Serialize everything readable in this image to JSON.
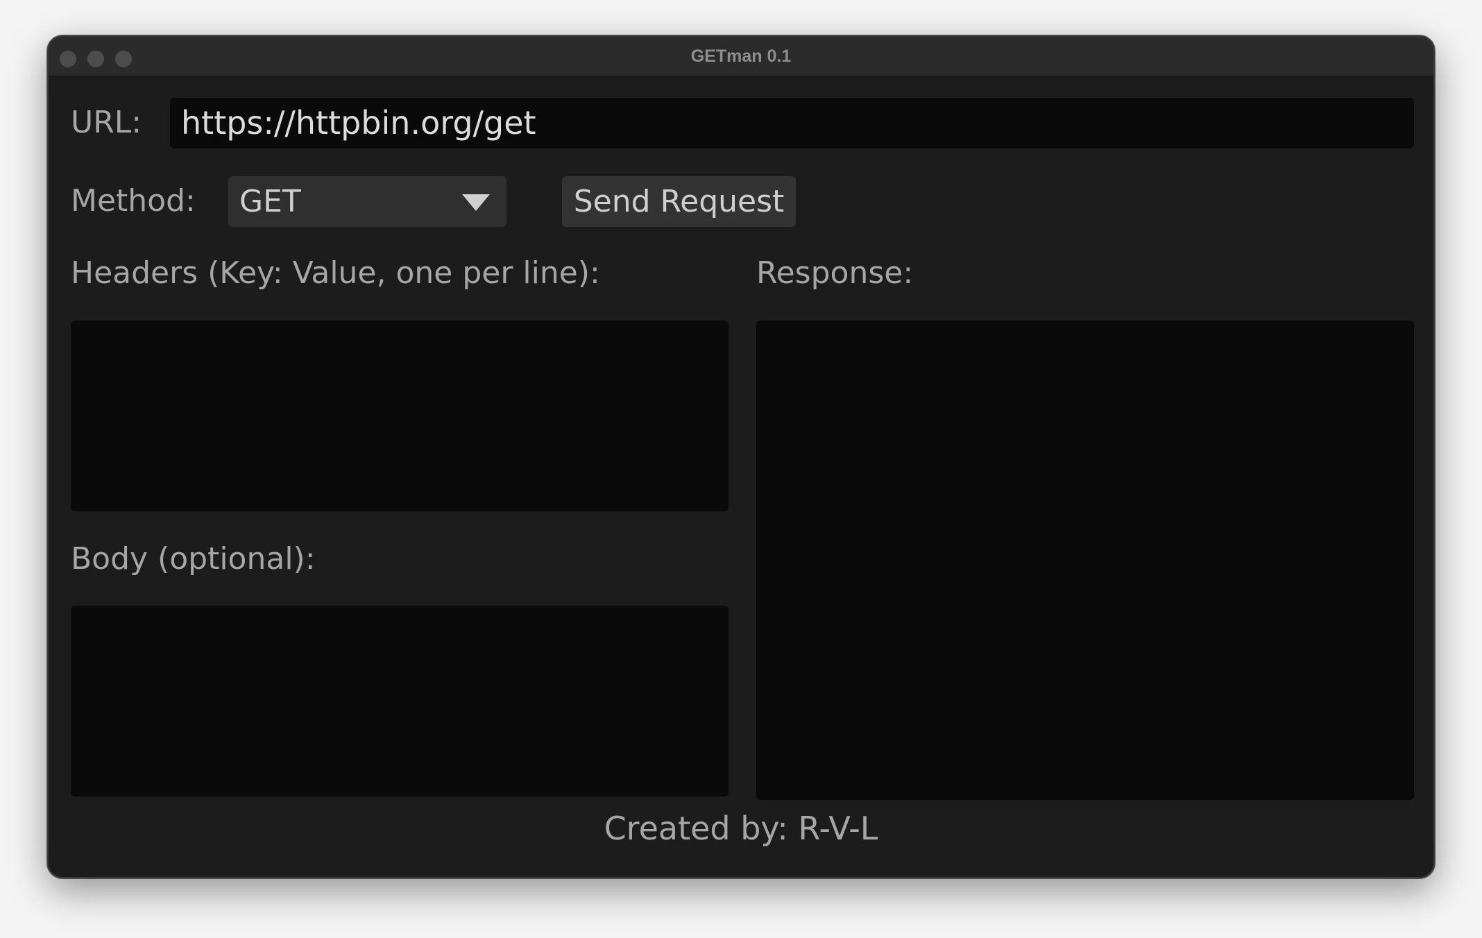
{
  "window": {
    "title": "GETman 0.1"
  },
  "form": {
    "url_label": "URL:",
    "url_value": "https://httpbin.org/get",
    "method_label": "Method:",
    "method_selected": "GET",
    "send_label": "Send Request",
    "headers_label": "Headers (Key: Value, one per line):",
    "headers_value": "",
    "body_label": "Body (optional):",
    "body_value": "",
    "response_label": "Response:",
    "response_value": ""
  },
  "footer": {
    "text": "Created by: R-V-L"
  },
  "icons": {
    "dropdown": "chevron-down-icon",
    "window_controls": [
      "close-icon",
      "minimize-icon",
      "zoom-icon"
    ]
  },
  "colors": {
    "window_background": "#1c1c1c",
    "titlebar_background": "#2b2b2b",
    "input_background": "#0a0a0a",
    "button_background": "#333333",
    "label_text": "#a6a6a6"
  }
}
